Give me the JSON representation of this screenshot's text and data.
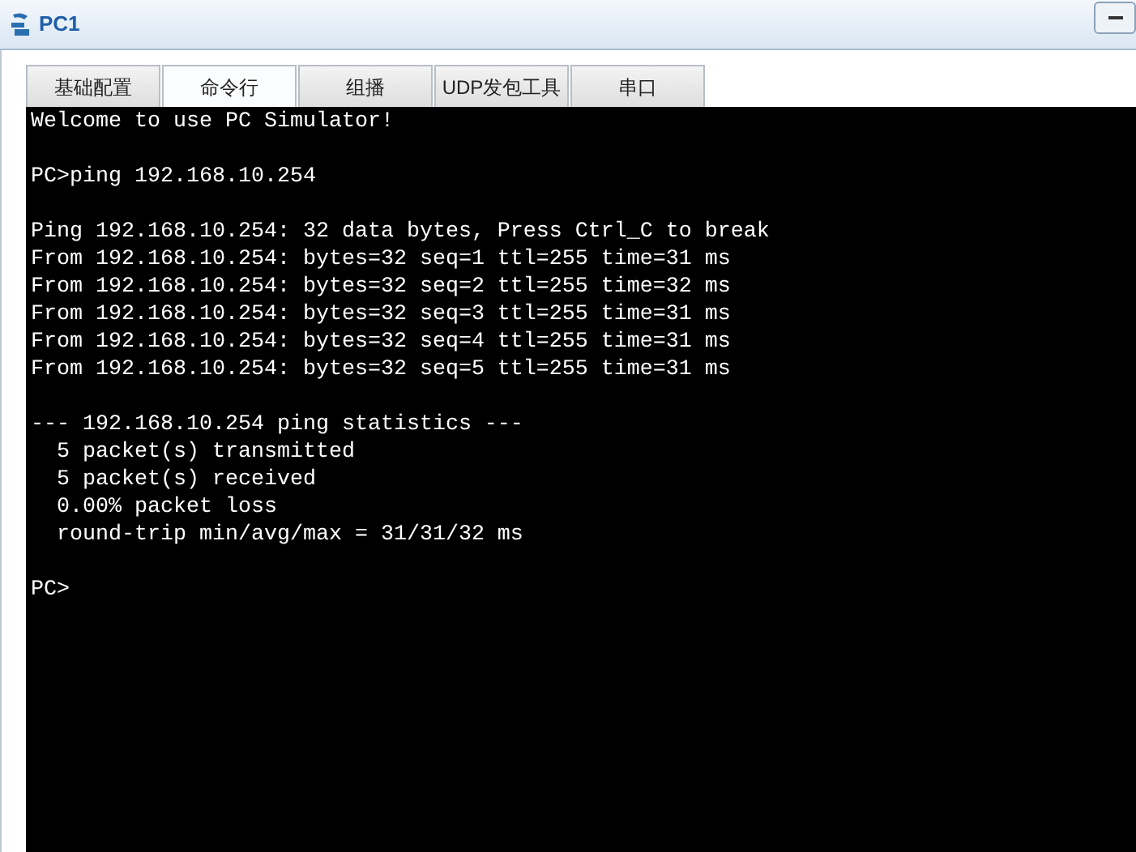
{
  "window": {
    "title": "PC1"
  },
  "tabs": [
    {
      "label": "基础配置",
      "selected": false
    },
    {
      "label": "命令行",
      "selected": true
    },
    {
      "label": "组播",
      "selected": false
    },
    {
      "label": "UDP发包工具",
      "selected": false
    },
    {
      "label": "串口",
      "selected": false
    }
  ],
  "terminal": {
    "blocks": [
      [
        "Welcome to use PC Simulator!"
      ],
      [
        "PC>ping 192.168.10.254"
      ],
      [
        "Ping 192.168.10.254: 32 data bytes, Press Ctrl_C to break",
        "From 192.168.10.254: bytes=32 seq=1 ttl=255 time=31 ms",
        "From 192.168.10.254: bytes=32 seq=2 ttl=255 time=32 ms",
        "From 192.168.10.254: bytes=32 seq=3 ttl=255 time=31 ms",
        "From 192.168.10.254: bytes=32 seq=4 ttl=255 time=31 ms",
        "From 192.168.10.254: bytes=32 seq=5 ttl=255 time=31 ms"
      ],
      [
        "--- 192.168.10.254 ping statistics ---",
        "  5 packet(s) transmitted",
        "  5 packet(s) received",
        "  0.00% packet loss",
        "  round-trip min/avg/max = 31/31/32 ms"
      ],
      [
        "PC>"
      ]
    ]
  }
}
